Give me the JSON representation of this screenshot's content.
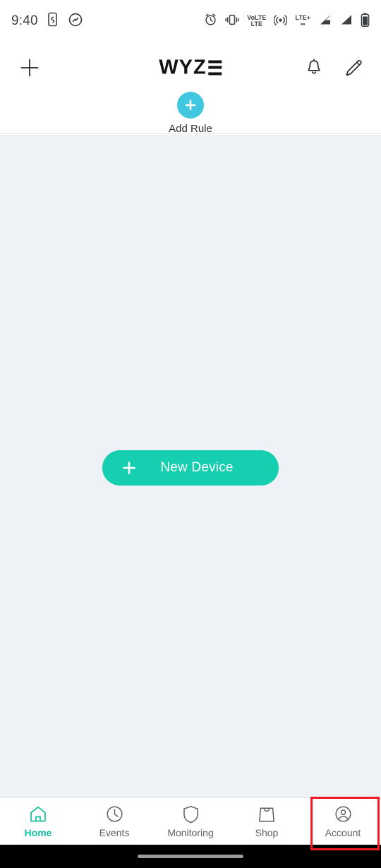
{
  "status_bar": {
    "time": "9:40",
    "left_icons": [
      "screen-record-icon",
      "shazam-icon"
    ],
    "right_icons": [
      "alarm-icon",
      "vibrate-icon",
      "volte-icon",
      "hotspot-icon",
      "lte-plus-icon",
      "signal-bars-icon",
      "signal-bars-2-icon",
      "battery-icon"
    ],
    "volte_top": "VoLTE",
    "volte_bottom": "LTE",
    "lte_label": "LTE+"
  },
  "header": {
    "add_button_label": "+",
    "logo_text": "WYZ",
    "logo_full": "WYZE",
    "bell_icon": "notification-bell-icon",
    "edit_icon": "edit-pencil-icon",
    "add_rule": {
      "label": "Add Rule",
      "icon": "plus-icon",
      "circle_color": "#3fc8e0"
    }
  },
  "main": {
    "background_color": "#eef1f6",
    "new_device_button": {
      "label": "New Device",
      "icon": "plus-icon",
      "color": "#16cfb0"
    }
  },
  "bottom_nav": {
    "active_color": "#13bfa0",
    "inactive_color": "#5a5f66",
    "items": [
      {
        "label": "Home",
        "icon": "home-icon",
        "active": true
      },
      {
        "label": "Events",
        "icon": "clock-icon",
        "active": false
      },
      {
        "label": "Monitoring",
        "icon": "shield-icon",
        "active": false
      },
      {
        "label": "Shop",
        "icon": "shopping-bag-icon",
        "active": false
      },
      {
        "label": "Account",
        "icon": "user-circle-icon",
        "active": false
      }
    ]
  },
  "annotation": {
    "highlight_target": "Account",
    "highlight_color": "#ee1c25"
  }
}
